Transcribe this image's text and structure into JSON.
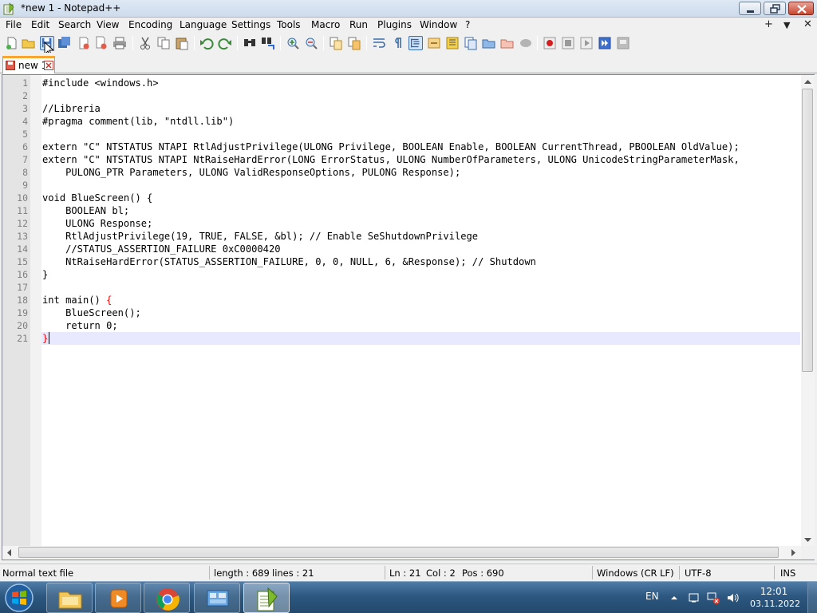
{
  "window": {
    "title": "*new 1 - Notepad++"
  },
  "menu": {
    "items": [
      "File",
      "Edit",
      "Search",
      "View",
      "Encoding",
      "Language",
      "Settings",
      "Tools",
      "Macro",
      "Run",
      "Plugins",
      "Window",
      "?"
    ],
    "right": [
      "+",
      "▼",
      "✕"
    ]
  },
  "toolbar": {
    "buttons": [
      "new-file",
      "open-file",
      "save",
      "save-all",
      "close",
      "close-all",
      "print",
      "cut",
      "copy",
      "paste",
      "undo",
      "redo",
      "find",
      "replace",
      "zoom-in",
      "zoom-out",
      "sync-vertical",
      "sync-horizontal",
      "word-wrap",
      "show-all-characters",
      "indent-guide",
      "user-defined-language",
      "document-map",
      "function-list",
      "folder-as-workspace",
      "monitoring",
      "record-macro",
      "stop-recording",
      "playback-macro",
      "run-macro-multiple",
      "save-macro"
    ]
  },
  "tab": {
    "label": "new 1"
  },
  "editor": {
    "lines": [
      "#include <windows.h>",
      "",
      "//Libreria",
      "#pragma comment(lib, \"ntdll.lib\")",
      "",
      "extern \"C\" NTSTATUS NTAPI RtlAdjustPrivilege(ULONG Privilege, BOOLEAN Enable, BOOLEAN CurrentThread, PBOOLEAN OldValue);",
      "extern \"C\" NTSTATUS NTAPI NtRaiseHardError(LONG ErrorStatus, ULONG NumberOfParameters, ULONG UnicodeStringParameterMask,",
      "    PULONG_PTR Parameters, ULONG ValidResponseOptions, PULONG Response);",
      "",
      "void BlueScreen() {",
      "    BOOLEAN bl;",
      "    ULONG Response;",
      "    RtlAdjustPrivilege(19, TRUE, FALSE, &bl); // Enable SeShutdownPrivilege",
      "    //STATUS_ASSERTION_FAILURE 0xC0000420",
      "    NtRaiseHardError(STATUS_ASSERTION_FAILURE, 0, 0, NULL, 6, &Response); // Shutdown",
      "}",
      "",
      "int main() {",
      "    BlueScreen();",
      "    return 0;",
      "}"
    ],
    "current_line": 21
  },
  "status": {
    "doc_type": "Normal text file",
    "length": "length : 689",
    "lines": "lines : 21",
    "ln": "Ln : 21",
    "col": "Col : 2",
    "pos": "Pos : 690",
    "eol": "Windows (CR LF)",
    "encoding": "UTF-8",
    "mode": "INS"
  },
  "taskbar": {
    "apps": [
      "windows-explorer",
      "media-player",
      "google-chrome",
      "control-panel",
      "notepad-plus-plus"
    ],
    "active_app": "notepad-plus-plus",
    "language": "EN",
    "time": "12:01",
    "date": "03.11.2022"
  },
  "colors": {
    "tab_accent": "#f9a531",
    "current_line": "#e8e8ff",
    "brace_highlight": "#ff0000",
    "line_number": "#808080"
  }
}
